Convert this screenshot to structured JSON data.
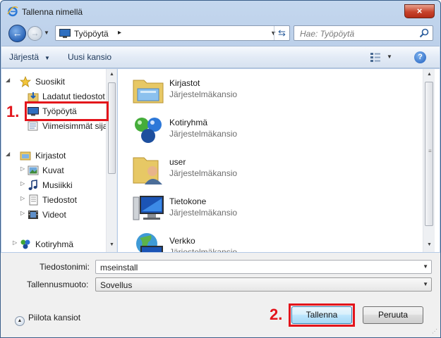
{
  "window": {
    "title": "Tallenna nimellä",
    "close_glyph": "×"
  },
  "address": {
    "location": "Työpöytä",
    "separator": "▸"
  },
  "search": {
    "placeholder": "Hae: Työpöytä"
  },
  "toolbar": {
    "organize_label": "Järjestä",
    "new_folder_label": "Uusi kansio",
    "help_glyph": "?"
  },
  "nav": {
    "favorites": "Suosikit",
    "downloads": "Ladatut tiedostot",
    "desktop": "Työpöytä",
    "recent": "Viimeisimmät sijainnit",
    "libraries": "Kirjastot",
    "pictures": "Kuvat",
    "music": "Musiikki",
    "documents": "Tiedostot",
    "videos": "Videot",
    "homegroup": "Kotiryhmä"
  },
  "files": [
    {
      "name": "Kirjastot",
      "type": "Järjestelmäkansio",
      "icon": "libraries-icon"
    },
    {
      "name": "Kotiryhmä",
      "type": "Järjestelmäkansio",
      "icon": "homegroup-icon"
    },
    {
      "name": "user",
      "type": "Järjestelmäkansio",
      "icon": "user-folder-icon"
    },
    {
      "name": "Tietokone",
      "type": "Järjestelmäkansio",
      "icon": "computer-icon"
    },
    {
      "name": "Verkko",
      "type": "Järjestelmäkansio",
      "icon": "network-icon"
    }
  ],
  "form": {
    "filename_label": "Tiedostonimi:",
    "filename_value": "mseinstall",
    "savetype_label": "Tallennusmuoto:",
    "savetype_value": "Sovellus"
  },
  "footer": {
    "hide_folders_label": "Piilota kansiot",
    "save_label": "Tallenna",
    "cancel_label": "Peruuta"
  },
  "annotations": {
    "step1": "1.",
    "step2": "2.",
    "color": "#e3141b"
  }
}
